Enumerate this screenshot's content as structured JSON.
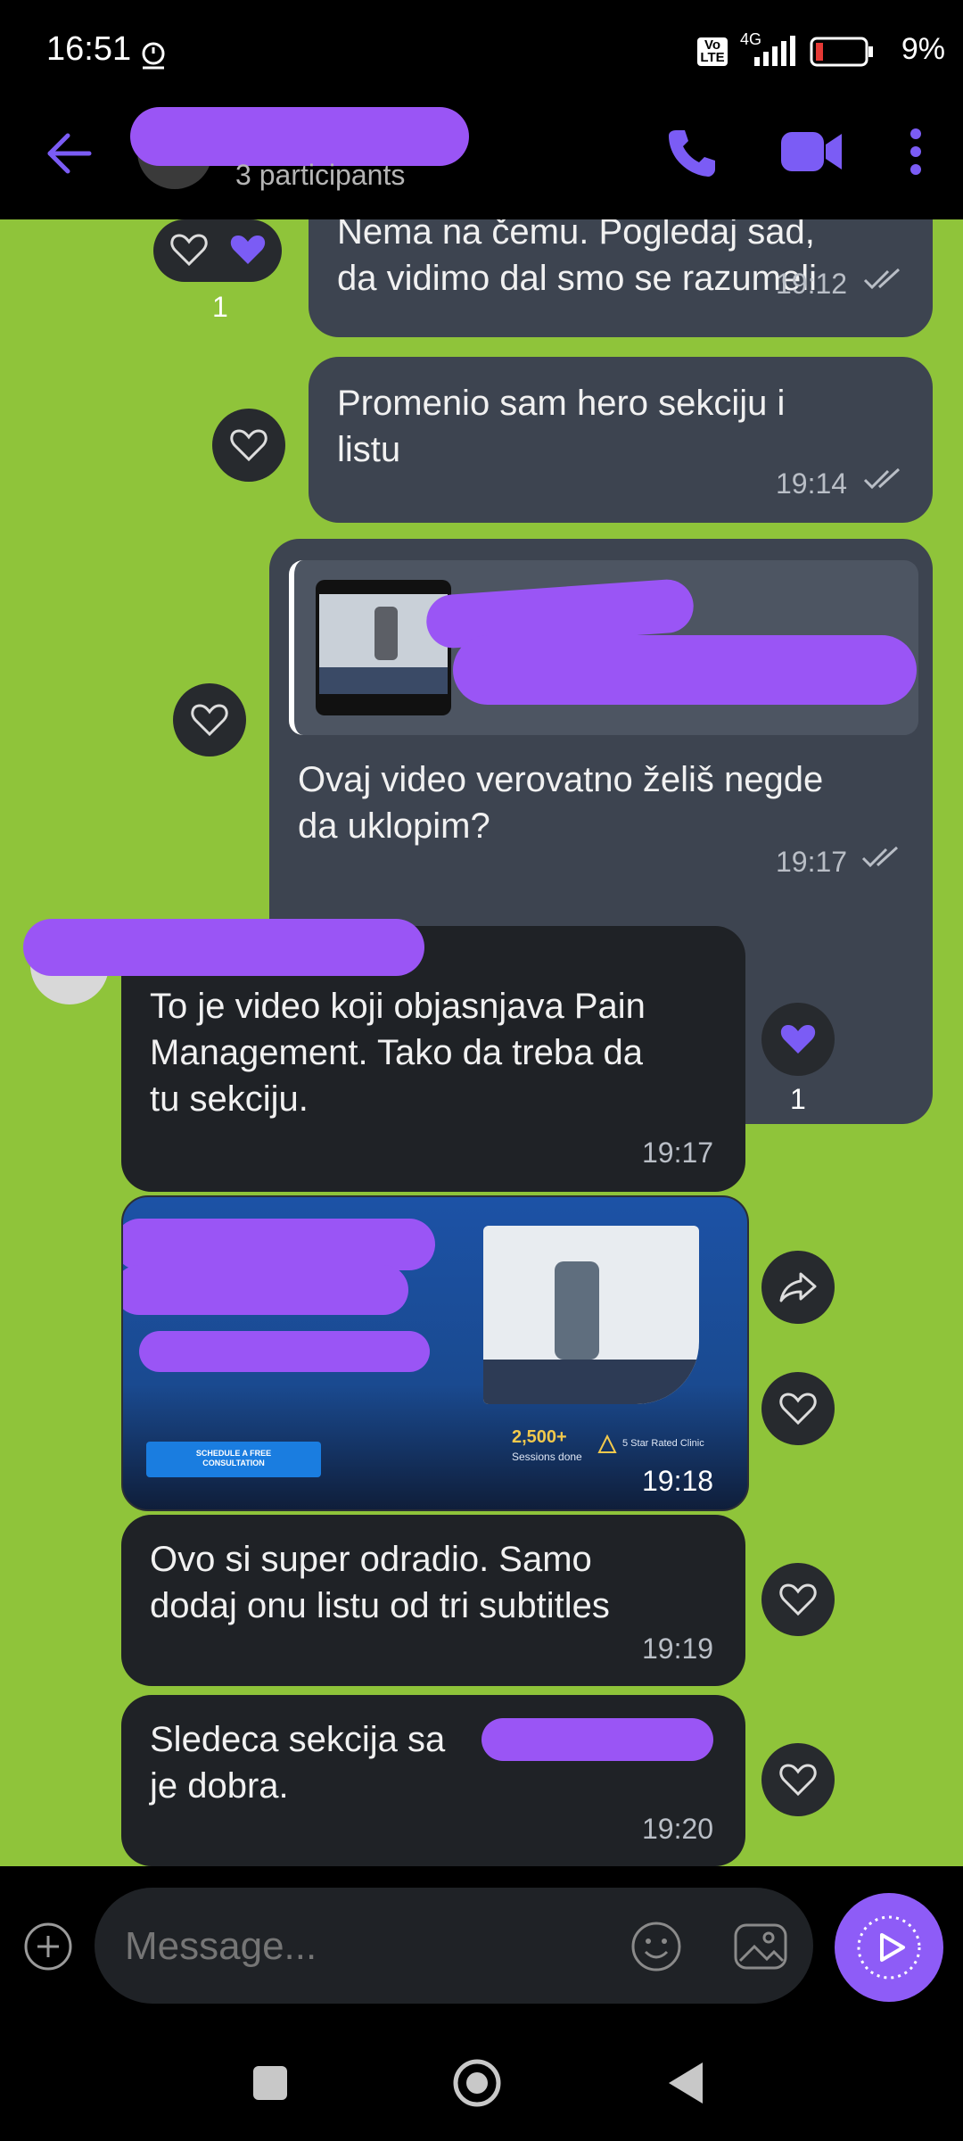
{
  "status_bar": {
    "time": "16:51",
    "network": "4G",
    "volte": "Vo LTE",
    "battery": "9%"
  },
  "header": {
    "subtitle": "3 participants",
    "icons": [
      "back-arrow-icon",
      "phone-icon",
      "video-camera-icon",
      "more-vertical-icon"
    ]
  },
  "messages": [
    {
      "id": "m1",
      "text": "Nema na čemu. Pogledaj sad,\nda vidimo dal smo se razumeli",
      "time": "19:12",
      "reaction_count": "1"
    },
    {
      "id": "m2",
      "text": "Promenio sam hero sekciju i\nlistu",
      "time": "19:14"
    },
    {
      "id": "m3",
      "text": "Ovaj video verovatno želiš negde\nda uklopim?",
      "time": "19:17"
    },
    {
      "id": "m4",
      "text": "To je video koji objasnjava Pain\nManagement. Tako da treba da\ntu sekciju.",
      "time": "19:17",
      "reaction_count": "1"
    },
    {
      "id": "m5",
      "time": "19:18",
      "image": {
        "button": "SCHEDULE A FREE\nCONSULTATION",
        "stat_value": "2,500+",
        "stat_label": "Sessions done",
        "rating": "5 Star Rated Clinic"
      }
    },
    {
      "id": "m6",
      "text": "Ovo si super odradio. Samo\ndodaj onu listu od tri subtitles",
      "time": "19:19"
    },
    {
      "id": "m7",
      "text": "Sledeca sekcija sa\nje dobra.",
      "time": "19:20"
    }
  ],
  "composer": {
    "placeholder": "Message..."
  },
  "colors": {
    "accent": "#7b5cf5",
    "chat_background": "#8fc43a",
    "outgoing_bubble": "#3d4450",
    "incoming_bubble": "#1f2226",
    "redaction": "#9a55f5"
  }
}
